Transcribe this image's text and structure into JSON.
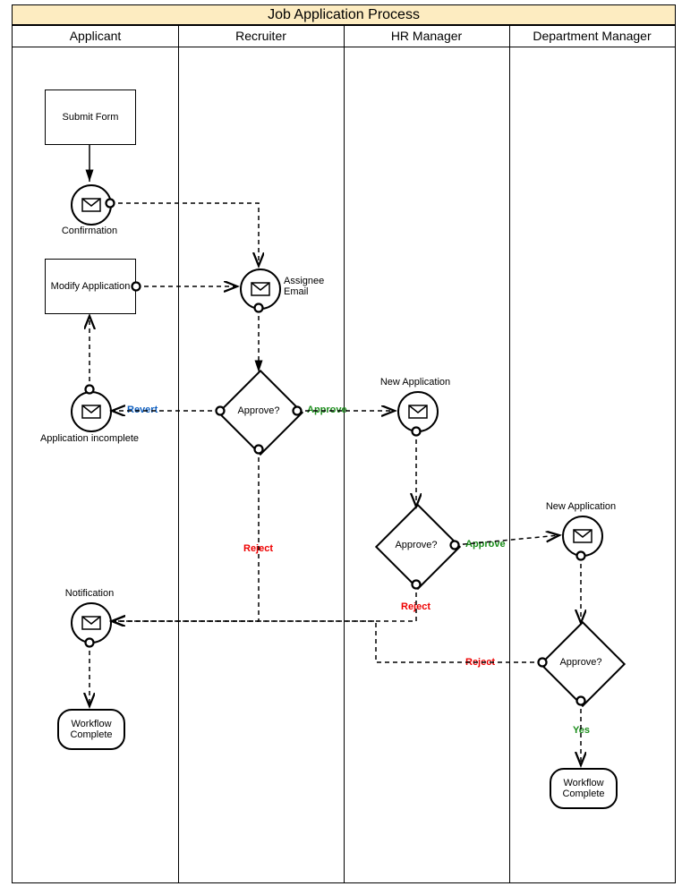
{
  "title": "Job Application Process",
  "lanes": {
    "applicant": "Applicant",
    "recruiter": "Recruiter",
    "hr": "HR Manager",
    "dm": "Department Manager"
  },
  "nodes": {
    "submit": "Submit Form",
    "confirmation": "Confirmation",
    "modify": "Modify Application",
    "assigneeEmail": "Assignee Email",
    "approve1": "Approve?",
    "appIncomplete": "Application incomplete",
    "notification": "Notification",
    "wfc1": "Workflow Complete",
    "newApp1": "New Application",
    "approve2": "Approve?",
    "newApp2": "New Application",
    "approve3": "Approve?",
    "wfc2": "Workflow Complete"
  },
  "edges": {
    "revert": "Revert",
    "approve": "Approve",
    "reject": "Reject",
    "yes": "Yes"
  }
}
